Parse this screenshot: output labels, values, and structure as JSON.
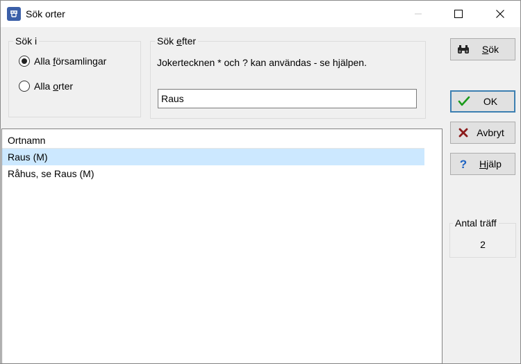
{
  "window": {
    "title": "Sök orter",
    "icon": "app-logo-icon"
  },
  "search_in": {
    "legend": "Sök i",
    "options": [
      {
        "label_pre": "Alla ",
        "label_u": "f",
        "label_post": "örsamlingar",
        "checked": true
      },
      {
        "label_pre": "Alla ",
        "label_u": "o",
        "label_post": "rter",
        "checked": false
      }
    ]
  },
  "search_for": {
    "legend_pre": "Sök ",
    "legend_u": "e",
    "legend_post": "fter",
    "hint": "Jokertecknen * och ? kan användas - se hjälpen.",
    "value": "Raus"
  },
  "results": {
    "header": "Ortnamn",
    "rows": [
      {
        "text": "Raus (M)",
        "selected": true
      },
      {
        "text": "Råhus, se Raus (M)",
        "selected": false
      }
    ]
  },
  "buttons": {
    "search_u": "S",
    "search_post": "ök",
    "ok": "OK",
    "cancel": "Avbryt",
    "help_u": "H",
    "help_post": "jälp"
  },
  "hits": {
    "legend": "Antal träff",
    "count": "2"
  }
}
